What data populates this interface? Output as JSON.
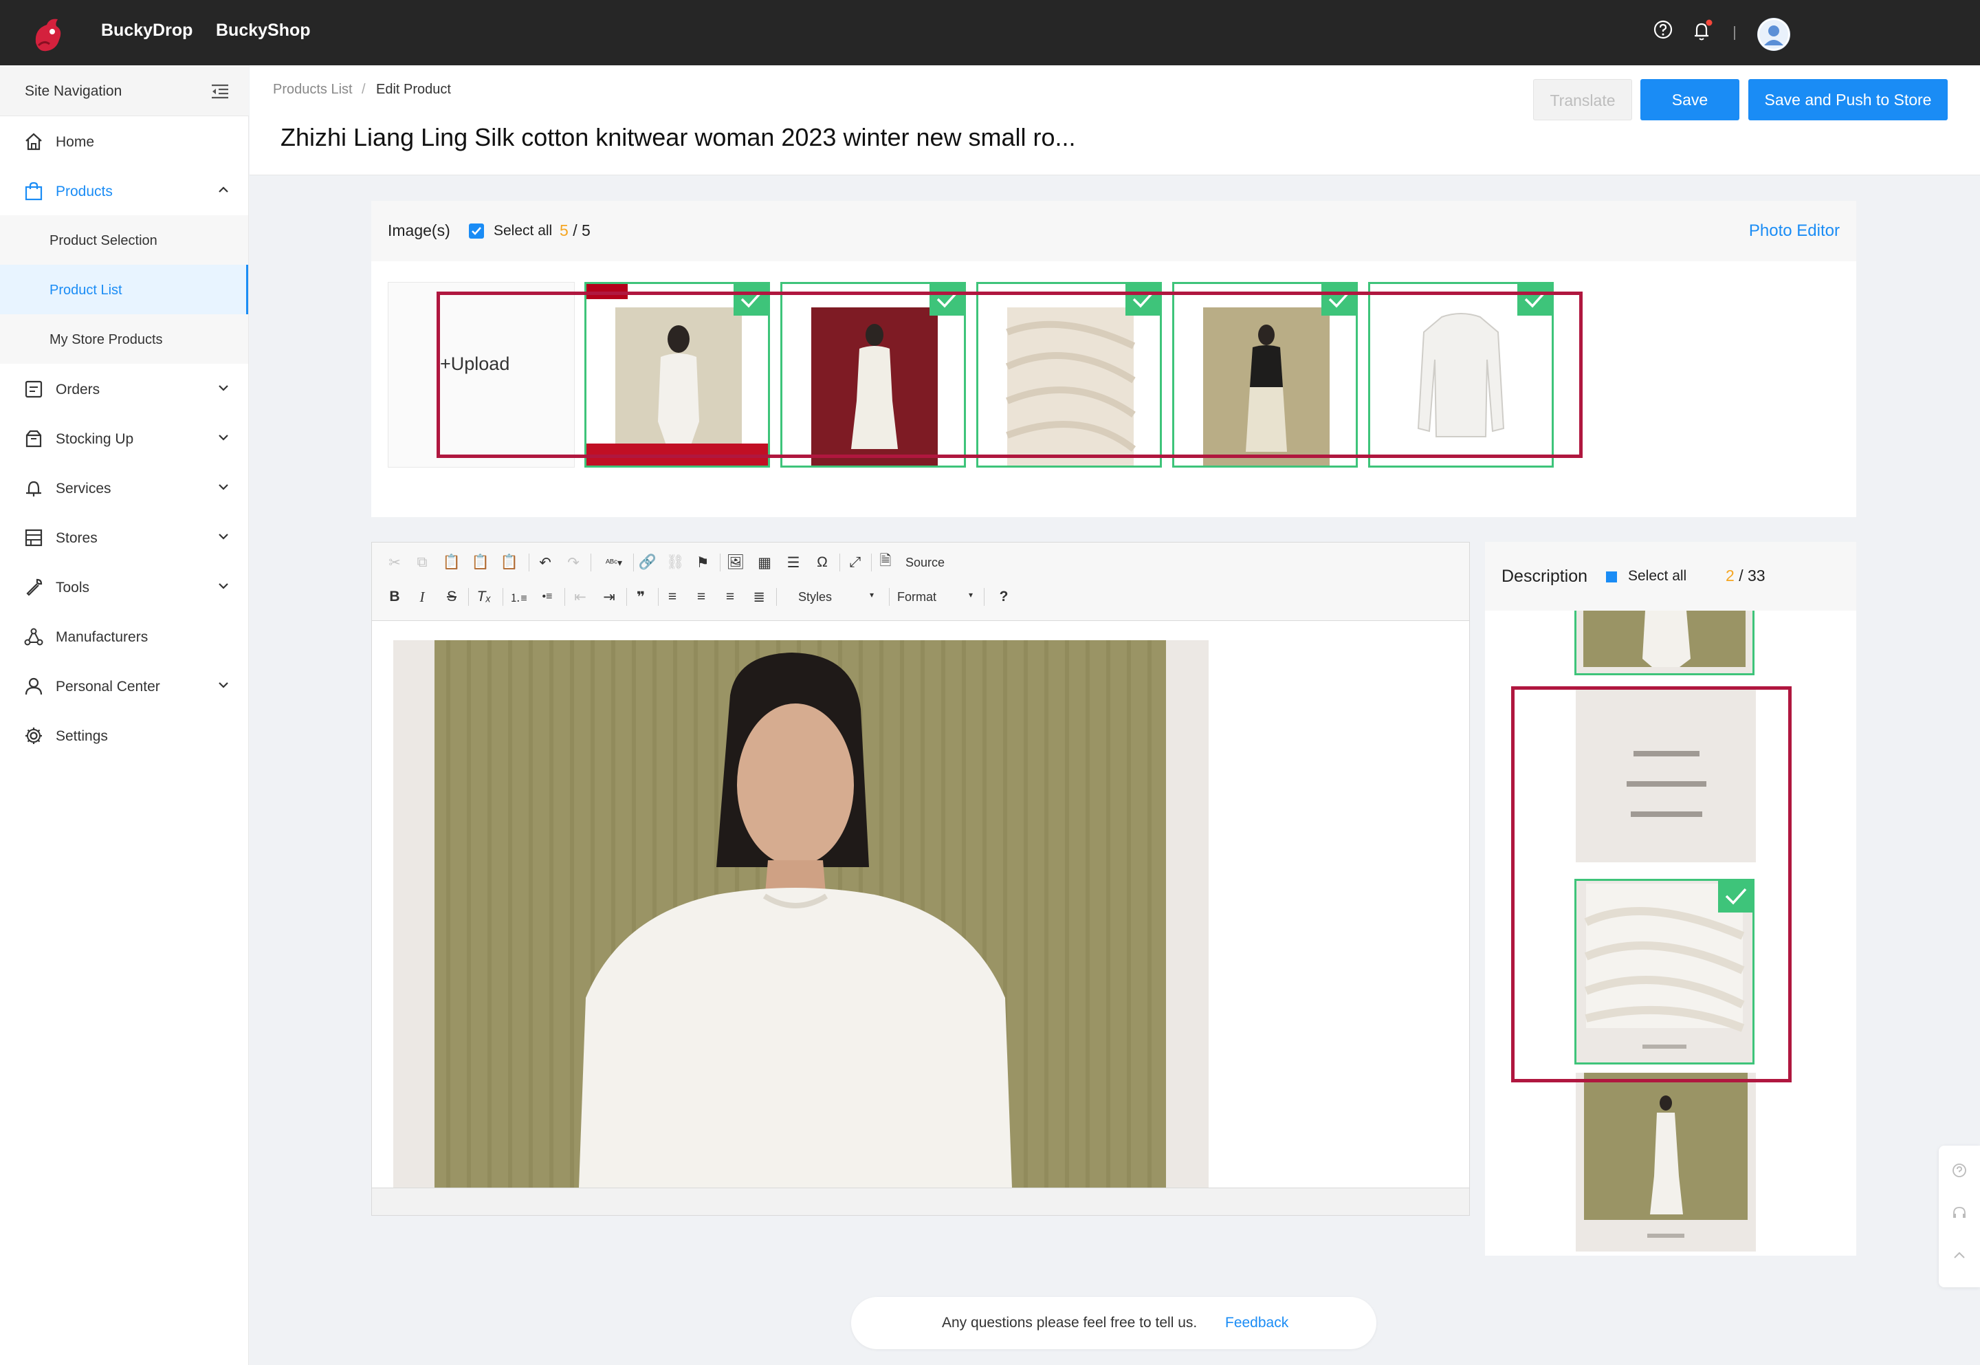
{
  "topbar": {
    "brand_1": "BuckyDrop",
    "brand_2": "BuckyShop",
    "logo_icon": "bucky-logo-icon",
    "help_icon": "help-circle-icon",
    "bell_icon": "bell-icon",
    "avatar_icon": "user-avatar-icon"
  },
  "sidebar": {
    "title": "Site Navigation",
    "collapse_icon": "menu-collapse-icon",
    "items": [
      {
        "label": "Home",
        "icon": "home-icon"
      },
      {
        "label": "Products",
        "icon": "shopping-bag-icon"
      },
      {
        "label": "Orders",
        "icon": "orders-icon"
      },
      {
        "label": "Stocking Up",
        "icon": "box-icon"
      },
      {
        "label": "Services",
        "icon": "services-icon"
      },
      {
        "label": "Stores",
        "icon": "store-icon"
      },
      {
        "label": "Tools",
        "icon": "wrench-icon"
      },
      {
        "label": "Manufacturers",
        "icon": "network-icon"
      },
      {
        "label": "Personal Center",
        "icon": "user-icon"
      },
      {
        "label": "Settings",
        "icon": "gear-icon"
      }
    ],
    "sub_items": [
      {
        "label": "Product Selection"
      },
      {
        "label": "Product List"
      },
      {
        "label": "My Store Products"
      }
    ]
  },
  "header": {
    "breadcrumb_1": "Products List",
    "breadcrumb_sep": "/",
    "breadcrumb_2": "Edit Product",
    "title": "Zhizhi Liang Ling Silk cotton knitwear woman 2023 winter new small ro...",
    "translate_label": "Translate",
    "save_label": "Save",
    "push_label": "Save and Push to Store"
  },
  "images": {
    "label": "Image(s)",
    "select_all": "Select all",
    "selected": "5",
    "sep": "/",
    "total": "5",
    "photo_editor": "Photo Editor",
    "upload_label": "+Upload"
  },
  "editor": {
    "source_label": "Source",
    "styles_label": "Styles",
    "format_label": "Format"
  },
  "description": {
    "title": "Description",
    "select_all": "Select all",
    "selected": "2",
    "sep": "/",
    "total": "33"
  },
  "footer": {
    "text": "Any questions please feel free to tell us.",
    "link": "Feedback"
  },
  "colors": {
    "accent": "#1a8cf5",
    "selected_border": "#3ec47a",
    "highlight_frame": "#b0173f",
    "count_orange": "#f5a623"
  }
}
